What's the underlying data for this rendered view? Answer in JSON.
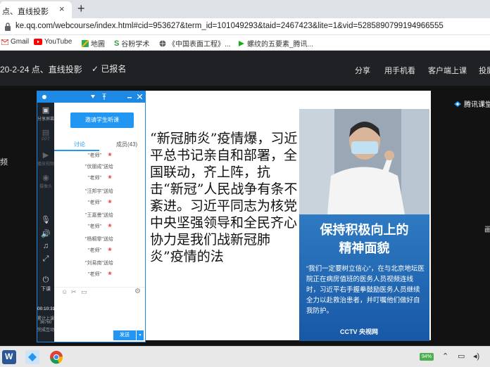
{
  "browser": {
    "tab_title": "点、直线投影",
    "tab_close": "×",
    "new_tab": "+",
    "url": "ke.qq.com/webcourse/index.html#cid=953627&term_id=101049293&taid=2467423&lite=1&vid=5285890799194966555"
  },
  "bookmarks": [
    {
      "icon": "gmail-icon",
      "label": "Gmail"
    },
    {
      "icon": "youtube-icon",
      "label": "YouTube"
    },
    {
      "icon": "maps-icon",
      "label": "地圖"
    },
    {
      "icon": "scholar-icon",
      "label": "谷粉学术"
    },
    {
      "icon": "globe-icon",
      "label": "《中国表面工程》..."
    },
    {
      "icon": "video-icon",
      "label": "螺纹的五要素_腾讯..."
    }
  ],
  "course": {
    "title": "20-2-24 点、直线投影",
    "enrolled": "✓ 已报名",
    "share": "分享",
    "phone_watch": "用手机看",
    "client_watch": "客户端上课",
    "cast": "投屏"
  },
  "video": {
    "left_edge_text": "频",
    "right_edge_text": "画",
    "brand": "腾讯课堂"
  },
  "class_panel": {
    "invite_button": "邀请学生听课",
    "tab_discuss": "讨论",
    "tab_members": "成员(43)",
    "tools": [
      {
        "icon": "share-screen-icon",
        "label": "分享屏幕"
      },
      {
        "icon": "ppt-icon",
        "label": "PPT"
      },
      {
        "icon": "play-video-icon",
        "label": "播放视频"
      },
      {
        "icon": "camera-icon",
        "label": "摄像头"
      },
      {
        "icon": "mic-icon",
        "label": ""
      },
      {
        "icon": "speaker-icon",
        "label": ""
      },
      {
        "icon": "music-icon",
        "label": ""
      },
      {
        "icon": "expand-icon",
        "label": ""
      },
      {
        "icon": "end-class-icon",
        "label": "下课"
      }
    ],
    "timer": "00:10:31",
    "stats_line1": "累计上课",
    "stats_line2": "36760",
    "stats_line3": "完成互动",
    "messages": [
      {
        "who": "",
        "to": "\"老师\""
      },
      {
        "who": "\"伏朋成\"送给",
        "to": "\"老师\""
      },
      {
        "who": "\"汪邦宇\"送给",
        "to": "\"老师\""
      },
      {
        "who": "\"王嘉曼\"送给",
        "to": "\"老师\""
      },
      {
        "who": "\"杨桐霏\"送给",
        "to": "\"老师\""
      },
      {
        "who": "\"刘易南\"送给",
        "to": "\"老师\""
      }
    ],
    "send_button": "发送",
    "send_arrow": "▾"
  },
  "slide": {
    "text": "“新冠肺炎”疫情爆，习近平总书记亲自和部署，全国联动，齐上阵，抗击“新冠”人民战争有条不紊进。习近平同志为核党中央坚强领导和全民齐心协力是我们战新冠肺炎”疫情的法",
    "panel_title_line1": "保持积极向上的",
    "panel_title_line2": "精神面貌",
    "panel_body": "“我们一定要树立信心”，在与北京地坛医院正在病房值班的医务人员视频连线时，习近平右手握拳鼓励医务人员继续全力以赴救治患者，并叮嘱他们做好自我防护。",
    "panel_logo": "CCTV 央视网"
  },
  "taskbar": {
    "battery": "94%"
  }
}
